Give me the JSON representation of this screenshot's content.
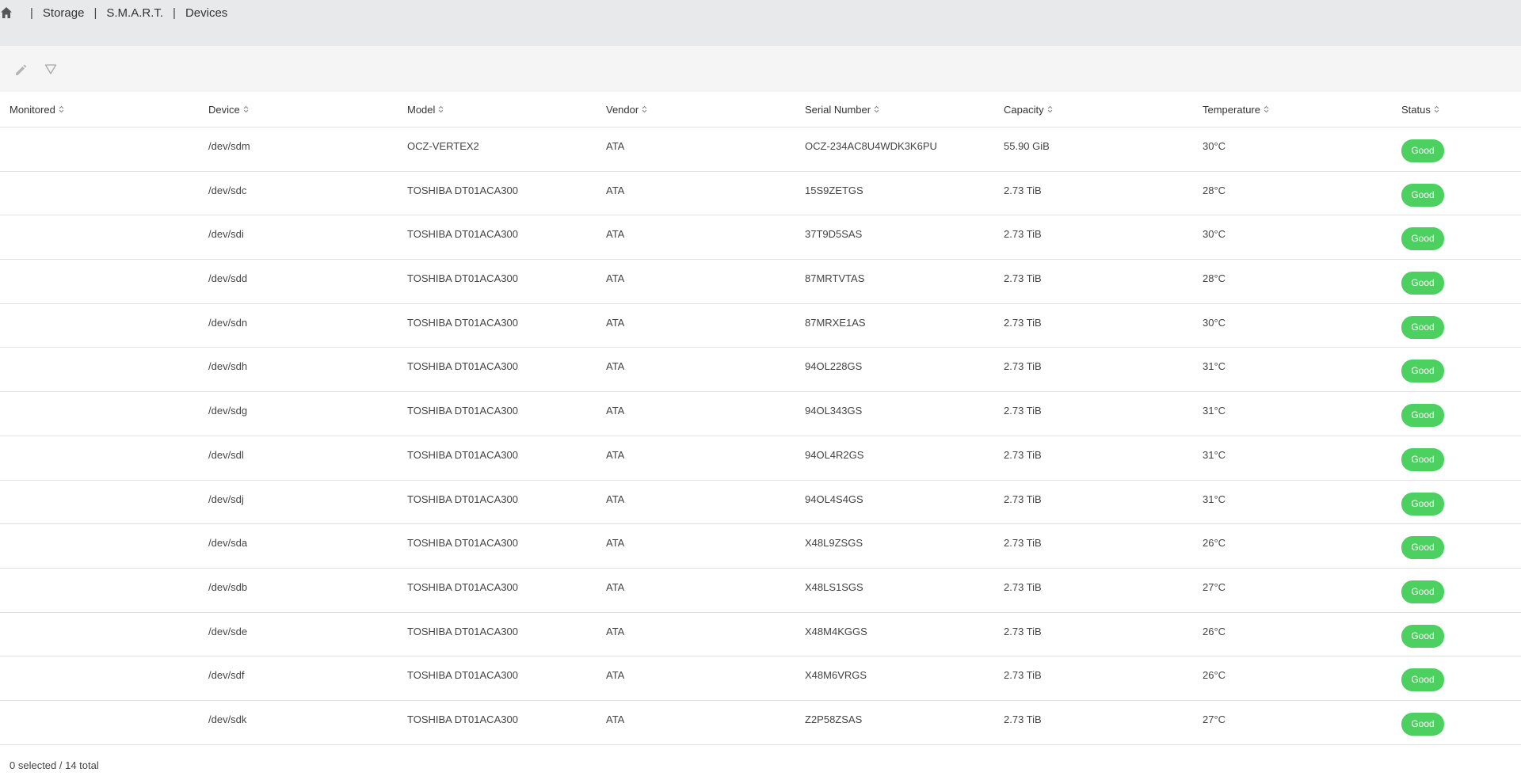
{
  "breadcrumb": {
    "items": [
      "Storage",
      "S.M.A.R.T.",
      "Devices"
    ]
  },
  "toolbar": {
    "edit_icon": "pencil-icon",
    "filter_icon": "filter-icon"
  },
  "table": {
    "columns": [
      "Monitored",
      "Device",
      "Model",
      "Vendor",
      "Serial Number",
      "Capacity",
      "Temperature",
      "Status"
    ],
    "rows": [
      {
        "monitored": "",
        "device": "/dev/sdm",
        "model": "OCZ-VERTEX2",
        "vendor": "ATA",
        "serial": "OCZ-234AC8U4WDK3K6PU",
        "capacity": "55.90 GiB",
        "temperature": "30°C",
        "status": "Good"
      },
      {
        "monitored": "",
        "device": "/dev/sdc",
        "model": "TOSHIBA DT01ACA300",
        "vendor": "ATA",
        "serial": "15S9ZETGS",
        "capacity": "2.73 TiB",
        "temperature": "28°C",
        "status": "Good"
      },
      {
        "monitored": "",
        "device": "/dev/sdi",
        "model": "TOSHIBA DT01ACA300",
        "vendor": "ATA",
        "serial": "37T9D5SAS",
        "capacity": "2.73 TiB",
        "temperature": "30°C",
        "status": "Good"
      },
      {
        "monitored": "",
        "device": "/dev/sdd",
        "model": "TOSHIBA DT01ACA300",
        "vendor": "ATA",
        "serial": "87MRTVTAS",
        "capacity": "2.73 TiB",
        "temperature": "28°C",
        "status": "Good"
      },
      {
        "monitored": "",
        "device": "/dev/sdn",
        "model": "TOSHIBA DT01ACA300",
        "vendor": "ATA",
        "serial": "87MRXE1AS",
        "capacity": "2.73 TiB",
        "temperature": "30°C",
        "status": "Good"
      },
      {
        "monitored": "",
        "device": "/dev/sdh",
        "model": "TOSHIBA DT01ACA300",
        "vendor": "ATA",
        "serial": "94OL228GS",
        "capacity": "2.73 TiB",
        "temperature": "31°C",
        "status": "Good"
      },
      {
        "monitored": "",
        "device": "/dev/sdg",
        "model": "TOSHIBA DT01ACA300",
        "vendor": "ATA",
        "serial": "94OL343GS",
        "capacity": "2.73 TiB",
        "temperature": "31°C",
        "status": "Good"
      },
      {
        "monitored": "",
        "device": "/dev/sdl",
        "model": "TOSHIBA DT01ACA300",
        "vendor": "ATA",
        "serial": "94OL4R2GS",
        "capacity": "2.73 TiB",
        "temperature": "31°C",
        "status": "Good"
      },
      {
        "monitored": "",
        "device": "/dev/sdj",
        "model": "TOSHIBA DT01ACA300",
        "vendor": "ATA",
        "serial": "94OL4S4GS",
        "capacity": "2.73 TiB",
        "temperature": "31°C",
        "status": "Good"
      },
      {
        "monitored": "",
        "device": "/dev/sda",
        "model": "TOSHIBA DT01ACA300",
        "vendor": "ATA",
        "serial": "X48L9ZSGS",
        "capacity": "2.73 TiB",
        "temperature": "26°C",
        "status": "Good"
      },
      {
        "monitored": "",
        "device": "/dev/sdb",
        "model": "TOSHIBA DT01ACA300",
        "vendor": "ATA",
        "serial": "X48LS1SGS",
        "capacity": "2.73 TiB",
        "temperature": "27°C",
        "status": "Good"
      },
      {
        "monitored": "",
        "device": "/dev/sde",
        "model": "TOSHIBA DT01ACA300",
        "vendor": "ATA",
        "serial": "X48M4KGGS",
        "capacity": "2.73 TiB",
        "temperature": "26°C",
        "status": "Good"
      },
      {
        "monitored": "",
        "device": "/dev/sdf",
        "model": "TOSHIBA DT01ACA300",
        "vendor": "ATA",
        "serial": "X48M6VRGS",
        "capacity": "2.73 TiB",
        "temperature": "26°C",
        "status": "Good"
      },
      {
        "monitored": "",
        "device": "/dev/sdk",
        "model": "TOSHIBA DT01ACA300",
        "vendor": "ATA",
        "serial": "Z2P58ZSAS",
        "capacity": "2.73 TiB",
        "temperature": "27°C",
        "status": "Good"
      }
    ]
  },
  "footer": {
    "summary": "0 selected / 14 total"
  },
  "colors": {
    "status_good": "#4cd160",
    "topbar_bg": "#e8e9eb",
    "toolbar_bg": "#f5f5f5"
  }
}
